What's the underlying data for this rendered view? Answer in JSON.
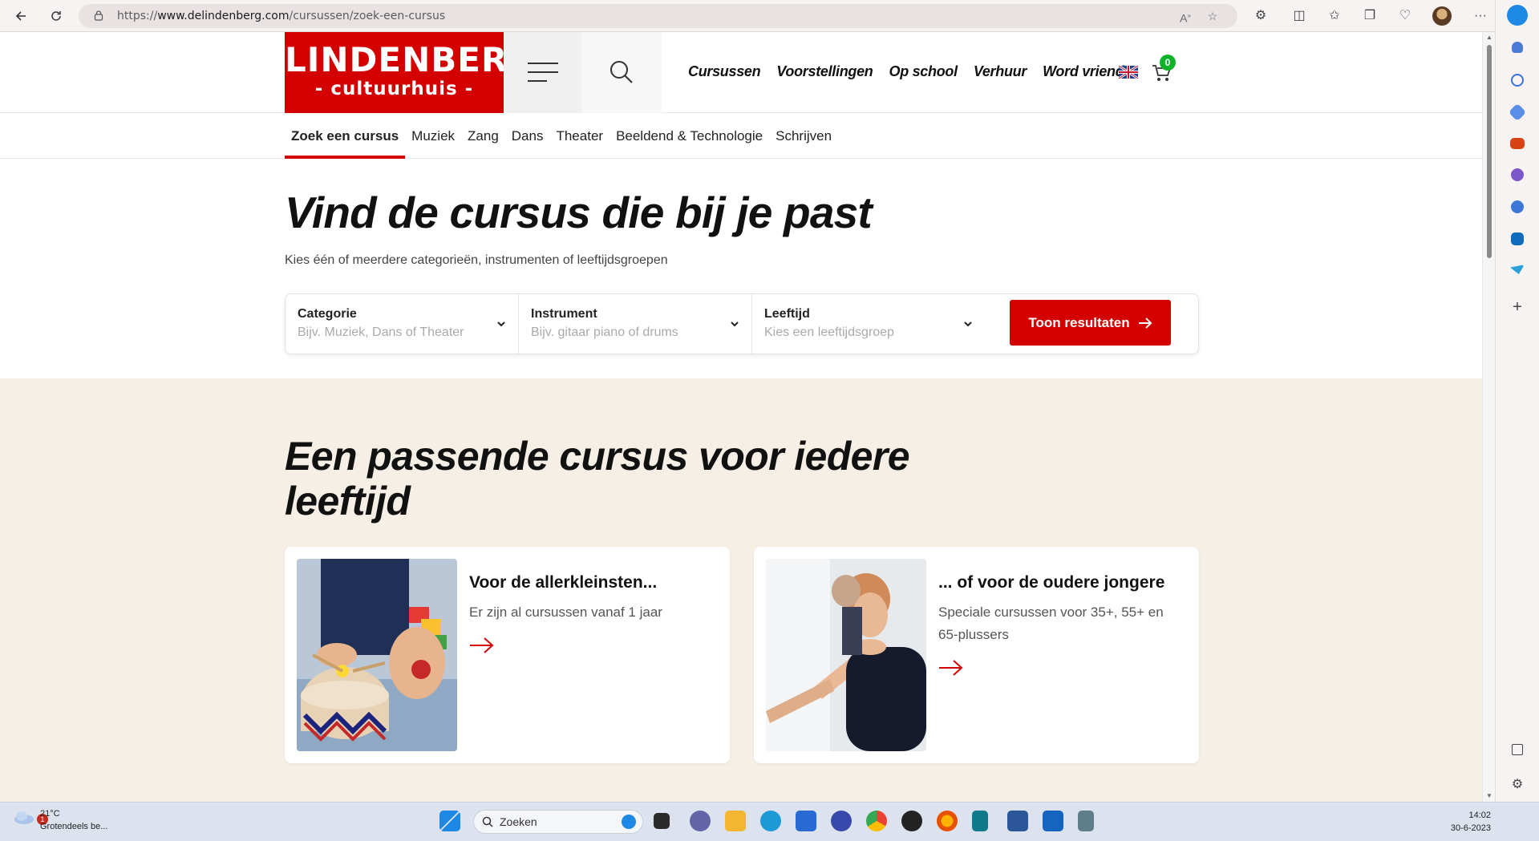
{
  "browser": {
    "url_prefix": "https://",
    "url_domain": "www.delindenberg.com",
    "url_path": "/cursussen/zoek-een-cursus"
  },
  "site": {
    "logo_line1": "LINDENBERG",
    "logo_line2": "- cultuurhuis -",
    "nav": [
      "Cursussen",
      "Voorstellingen",
      "Op school",
      "Verhuur",
      "Word vriend"
    ],
    "cart_count": "0",
    "brand_color": "#d40000"
  },
  "subnav": {
    "items": [
      "Zoek een cursus",
      "Muziek",
      "Zang",
      "Dans",
      "Theater",
      "Beeldend & Technologie",
      "Schrijven"
    ],
    "active": "Zoek een cursus"
  },
  "hero": {
    "title": "Vind de cursus die bij je past",
    "subtitle": "Kies één of meerdere categorieën, instrumenten of leeftijdsgroepen"
  },
  "filter": {
    "category_label": "Categorie",
    "category_placeholder": "Bijv. Muziek, Dans of Theater",
    "instrument_label": "Instrument",
    "instrument_placeholder": "Bijv. gitaar piano of drums",
    "age_label": "Leeftijd",
    "age_placeholder": "Kies een leeftijdsgroep",
    "button": "Toon resultaten"
  },
  "section": {
    "title": "Een passende cursus voor iedere leeftijd",
    "cards": [
      {
        "title": "Voor de allerkleinsten...",
        "text": "Er zijn al cursussen vanaf 1 jaar"
      },
      {
        "title": "... of voor de oudere jongere",
        "text": "Speciale cursussen voor 35+, 55+ en 65-plussers"
      }
    ]
  },
  "taskbar": {
    "temp": "21°C",
    "weather": "Grotendeels be...",
    "weather_badge": "1",
    "search": "Zoeken",
    "time": "14:02",
    "date": "30-6-2023"
  }
}
